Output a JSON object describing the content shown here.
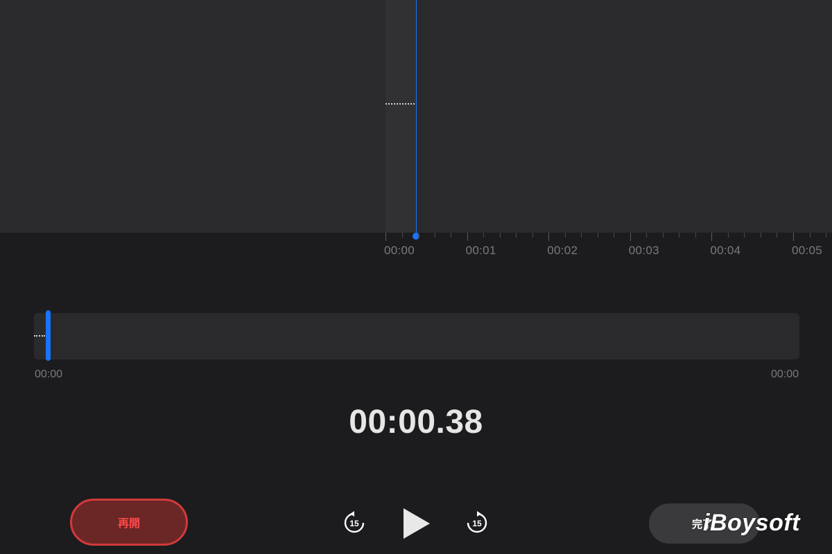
{
  "colors": {
    "accent": "#1a73ff",
    "record_red": "#d23a3a",
    "background": "#1c1c1e",
    "panel": "#2a2a2c"
  },
  "ruler": {
    "labels": [
      "00:00",
      "00:01",
      "00:02",
      "00:03",
      "00:04",
      "00:05"
    ]
  },
  "overview": {
    "start_time": "00:00",
    "end_time": "00:00"
  },
  "timer": "00:00.38",
  "controls": {
    "resume_label": "再開",
    "skip_back_seconds": "15",
    "skip_forward_seconds": "15",
    "done_label": "完了",
    "skip_back_icon": "rewind-15-icon",
    "play_icon": "play-icon",
    "skip_forward_icon": "forward-15-icon"
  },
  "watermark": "iBoysoft"
}
